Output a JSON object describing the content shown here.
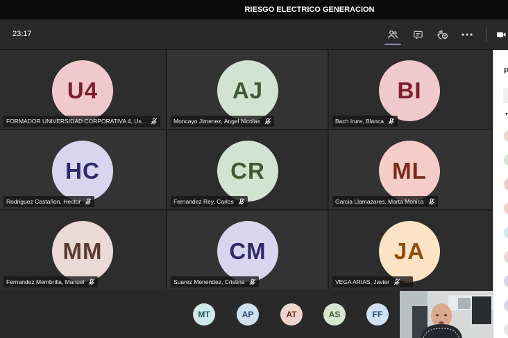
{
  "window": {
    "title": "RIESGO ELECTRICO GENERACION"
  },
  "toolbar": {
    "timer": "23:17",
    "icons": [
      "participants-icon",
      "chat-icon",
      "reactions-icon",
      "more-icon",
      "camera-icon"
    ]
  },
  "participants": [
    {
      "initials": "U4",
      "name": "FORMADOR UNIVERSIDAD CORPORATIVA 4, Us...",
      "bg": "#f0c9cc",
      "fg": "#7a1e2a",
      "muted": true
    },
    {
      "initials": "AJ",
      "name": "Moncayo Jimenez, Angel Nicolas",
      "bg": "#d3e3d1",
      "fg": "#3d5a35",
      "muted": true
    },
    {
      "initials": "BI",
      "name": "Bach Irure, Blanca",
      "bg": "#f0c9cc",
      "fg": "#7a1e2a",
      "muted": true
    },
    {
      "initials": "HC",
      "name": "Rodriguez Castañon, Hector",
      "bg": "#d9d5ee",
      "fg": "#2e2a6b",
      "muted": true
    },
    {
      "initials": "CR",
      "name": "Fernandez Rey, Carlos",
      "bg": "#d3e3d1",
      "fg": "#3d5a35",
      "muted": true
    },
    {
      "initials": "ML",
      "name": "Garcia Llamazares, Marta Monica",
      "bg": "#f4cdc6",
      "fg": "#7a2a1a",
      "muted": true
    },
    {
      "initials": "MM",
      "name": "Fernandez Membrilla, Manuel",
      "bg": "#ead9d4",
      "fg": "#5a3a30",
      "muted": true
    },
    {
      "initials": "CM",
      "name": "Suarez Menendez, Cristina",
      "bg": "#d9d5ee",
      "fg": "#2e2a6b",
      "muted": true
    },
    {
      "initials": "JA",
      "name": "VEGA ARIAS, Javier",
      "bg": "#fde3c5",
      "fg": "#8a4e0e",
      "muted": true,
      "more": "···"
    }
  ],
  "overflow_participants": [
    {
      "initials": "MT",
      "bg": "#cde9ea",
      "fg": "#1f5a5e"
    },
    {
      "initials": "AP",
      "bg": "#cfe0f0",
      "fg": "#24466b"
    },
    {
      "initials": "AT",
      "bg": "#f0d5cc",
      "fg": "#6b3020"
    },
    {
      "initials": "AS",
      "bg": "#d7e6cf",
      "fg": "#3d5a2e"
    },
    {
      "initials": "FF",
      "bg": "#cfe2f3",
      "fg": "#24466b"
    }
  ],
  "side_panel": {
    "title": "P",
    "dots": [
      "#f0d5cc",
      "#d3e3d1",
      "#f0c9cc",
      "#f4cdc6",
      "#cde9ea",
      "#ead9d4",
      "#d9d5ee",
      "#d9d5ee",
      "#e5e5e5"
    ]
  }
}
